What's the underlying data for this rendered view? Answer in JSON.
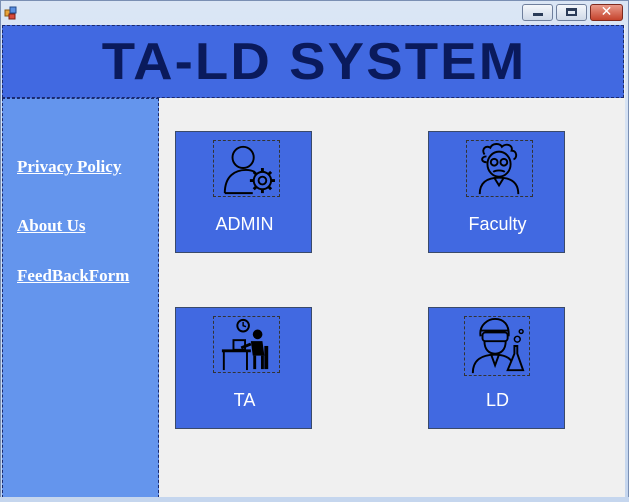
{
  "header": {
    "title": "TA-LD SYSTEM"
  },
  "sidebar": {
    "links": [
      {
        "label": "Privacy Policy"
      },
      {
        "label": "About Us"
      },
      {
        "label": "FeedBackForm"
      }
    ]
  },
  "tiles": [
    {
      "label": "ADMIN",
      "icon": "admin-gear-user-icon"
    },
    {
      "label": "Faculty",
      "icon": "professor-icon"
    },
    {
      "label": "TA",
      "icon": "person-at-desk-icon"
    },
    {
      "label": "LD",
      "icon": "scientist-icon"
    }
  ],
  "colors": {
    "header_bg": "#4169e1",
    "sidebar_bg": "#6495ed",
    "tile_bg": "#4169e1",
    "title_text": "#0a1a5c"
  }
}
